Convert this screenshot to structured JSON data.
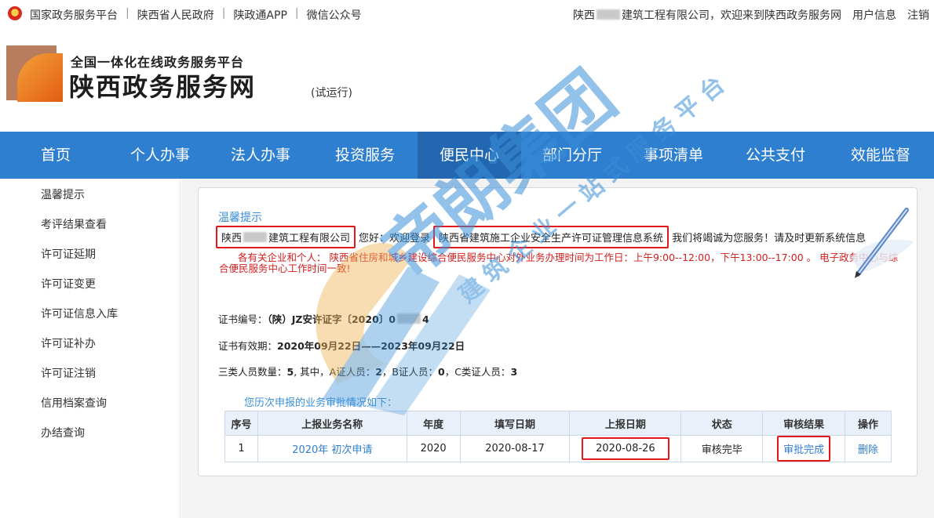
{
  "topbar": {
    "links": [
      "国家政务服务平台",
      "陕西省人民政府",
      "陕政通APP",
      "微信公众号"
    ],
    "welcome_prefix": "陕西",
    "welcome_suffix": "建筑工程有限公司，欢迎来到陕西政务服务网",
    "user_info": "用户信息",
    "logout": "注销"
  },
  "header": {
    "subtitle": "全国一体化在线政务服务平台",
    "title": "陕西政务服务网",
    "trial": "(试运行)"
  },
  "nav": {
    "items": [
      "首页",
      "个人办事",
      "法人办事",
      "投资服务",
      "便民中心",
      "部门分厅",
      "事项清单",
      "公共支付",
      "效能监督"
    ],
    "active_index": 4
  },
  "sidebar": {
    "items": [
      "温馨提示",
      "考评结果查看",
      "许可证延期",
      "许可证变更",
      "许可证信息入库",
      "许可证补办",
      "许可证注销",
      "信用档案查询",
      "办结查询"
    ]
  },
  "panel": {
    "tip_title": "温馨提示",
    "company_prefix": "陕西",
    "company_suffix": "建筑工程有限公司",
    "greeting": "您好：欢迎登录",
    "system_name": "陕西省建筑施工企业安全生产许可证管理信息系统",
    "greeting_end": "我们将竭诚为您服务！请及时更新系统信息",
    "notice": "各有关企业和个人：  陕西省住房和城乡建设综合便民服务中心对外业务办理时间为工作日：上午9:00--12:00，下午13:00--17:00 。 电子政务中心与综合便民服务中心工作时间一致!",
    "cert_no_label": "证书编号：",
    "cert_no_prefix": "（陕）JZ安许证字〔2020〕0",
    "cert_no_suffix": "4",
    "validity_label": "证书有效期：",
    "validity_value": "2020年09月22日——2023年09月22日",
    "staff_label": "三类人员数量：",
    "staff_total": "5",
    "staff_mid": ", 其中，A证人员：",
    "staff_a": "2",
    "staff_b_label": "，B证人员：",
    "staff_b": "0",
    "staff_c_label": "，C类证人员：",
    "staff_c": "3",
    "history_title": "您历次申报的业务审批情况如下："
  },
  "table": {
    "headers": [
      "序号",
      "上报业务名称",
      "年度",
      "填写日期",
      "上报日期",
      "状态",
      "审核结果",
      "操作"
    ],
    "rows": [
      {
        "no": "1",
        "name": "2020年 初次申请",
        "year": "2020",
        "fill_date": "2020-08-17",
        "report_date": "2020-08-26",
        "status": "审核完毕",
        "result": "审批完成",
        "action": "删除"
      }
    ]
  },
  "watermark": {
    "brand": "帝朗集团",
    "slogan": "建筑企业一站式服务平台"
  },
  "colors": {
    "nav_bg": "#2f7fd1",
    "nav_active": "#2267b0",
    "link": "#2f7fd1",
    "notice_red": "#d21f1f",
    "highlight_red": "#e0191c"
  }
}
